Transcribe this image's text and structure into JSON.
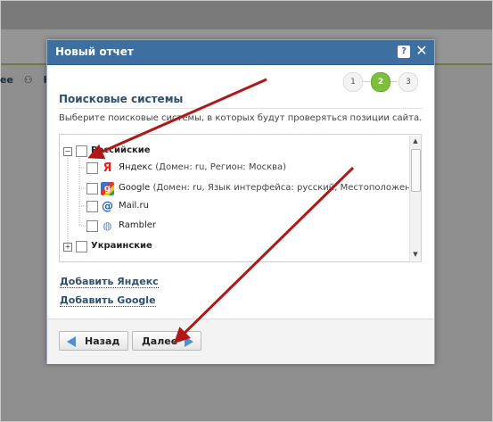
{
  "background_page": {
    "links": [
      "ее",
      "Ко"
    ]
  },
  "dialog": {
    "title": "Новый отчет",
    "help_label": "?",
    "close_label": "✕",
    "steps": [
      "1",
      "2",
      "3"
    ],
    "active_step": "2",
    "section_title": "Поисковые системы",
    "description": "Выберите поисковые системы, в которых будут проверяться позиции сайта.",
    "tree": {
      "groups": [
        {
          "label": "Российские",
          "expander": "−",
          "items": [
            {
              "label": "Яндекс",
              "meta": " (Домен: ru, Регион: Москва)",
              "icon": "yandex-icon",
              "icon_glyph": "Я"
            },
            {
              "label": "Google",
              "meta": " (Домен: ru, Язык интерфейса: русский, Местоположение",
              "icon": "google-icon",
              "icon_glyph": "g"
            },
            {
              "label": "Mail.ru",
              "meta": "",
              "icon": "mail-icon",
              "icon_glyph": "@"
            },
            {
              "label": "Rambler",
              "meta": "",
              "icon": "rambler-icon",
              "icon_glyph": "◍"
            }
          ]
        },
        {
          "label": "Украинские",
          "expander": "+",
          "items": []
        }
      ]
    },
    "links": {
      "add_yandex": "Добавить Яндекс",
      "add_google": "Добавить Google"
    },
    "buttons": {
      "back": "Назад",
      "next": "Далее"
    }
  },
  "colors": {
    "titlebar": "#3d6fa1",
    "active_step": "#7bbf3a",
    "annotation_arrow": "#b01818"
  }
}
